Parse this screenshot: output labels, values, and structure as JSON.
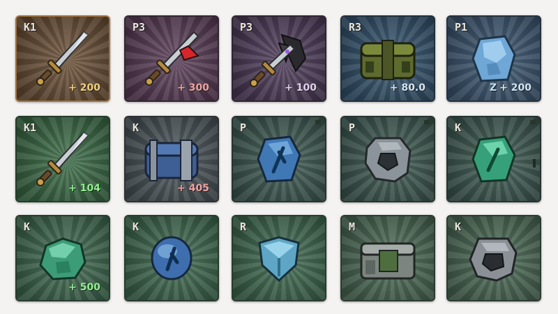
{
  "tiles": [
    {
      "rank": "K1",
      "bonus": "+ 200",
      "bonus_color": "#f2d07a",
      "bg": "brown",
      "icon": "sword-icon"
    },
    {
      "rank": "P3",
      "bonus": "+ 300",
      "bonus_color": "#f0a2a2",
      "bg": "purple",
      "icon": "red-tipped-sword-icon"
    },
    {
      "rank": "P3",
      "bonus": "+ 100",
      "bonus_color": "#e2d0ee",
      "bg": "violet",
      "icon": "dark-winged-sword-icon"
    },
    {
      "rank": "R3",
      "bonus": "+ 80.0",
      "bonus_color": "#d3e6f5",
      "bg": "blue",
      "icon": "moss-chest-icon"
    },
    {
      "rank": "P1",
      "bonus": "+ 200",
      "bonus_color": "#cfe6f7",
      "bg": "steel",
      "icon": "blue-crystal-icon",
      "extra": "Z"
    },
    {
      "rank": "K1",
      "bonus": "+ 104",
      "bonus_color": "#8ef28e",
      "bg": "green",
      "icon": "sword-icon"
    },
    {
      "rank": "K",
      "bonus": "+ 405",
      "bonus_color": "#f0a2a2",
      "bg": "slate",
      "icon": "blue-chest-icon"
    },
    {
      "rank": "P",
      "bonus": "",
      "bonus_color": "#ffffff",
      "bg": "teal",
      "icon": "blue-rune-icon",
      "corner_pip": true
    },
    {
      "rank": "P",
      "bonus": "",
      "bonus_color": "#ffffff",
      "bg": "teal",
      "icon": "stone-rune-icon",
      "corner_pip": true
    },
    {
      "rank": "K",
      "bonus": "",
      "bonus_color": "#ffffff",
      "bg": "teal",
      "icon": "green-crystal-icon",
      "corner_pip": true,
      "side_pip": true
    },
    {
      "rank": "K",
      "bonus": "+ 500",
      "bonus_color": "#8ef28e",
      "bg": "forest",
      "icon": "green-ore-icon"
    },
    {
      "rank": "K",
      "bonus": "",
      "bonus_color": "#ffffff",
      "bg": "forest",
      "icon": "blue-orb-rune-icon"
    },
    {
      "rank": "R",
      "bonus": "",
      "bonus_color": "#ffffff",
      "bg": "forest",
      "icon": "crystal-shield-icon"
    },
    {
      "rank": "M",
      "bonus": "",
      "bonus_color": "#ffffff",
      "bg": "moss",
      "icon": "stone-block-icon"
    },
    {
      "rank": "K",
      "bonus": "",
      "bonus_color": "#ffffff",
      "bg": "moss",
      "icon": "dark-stone-icon"
    }
  ]
}
